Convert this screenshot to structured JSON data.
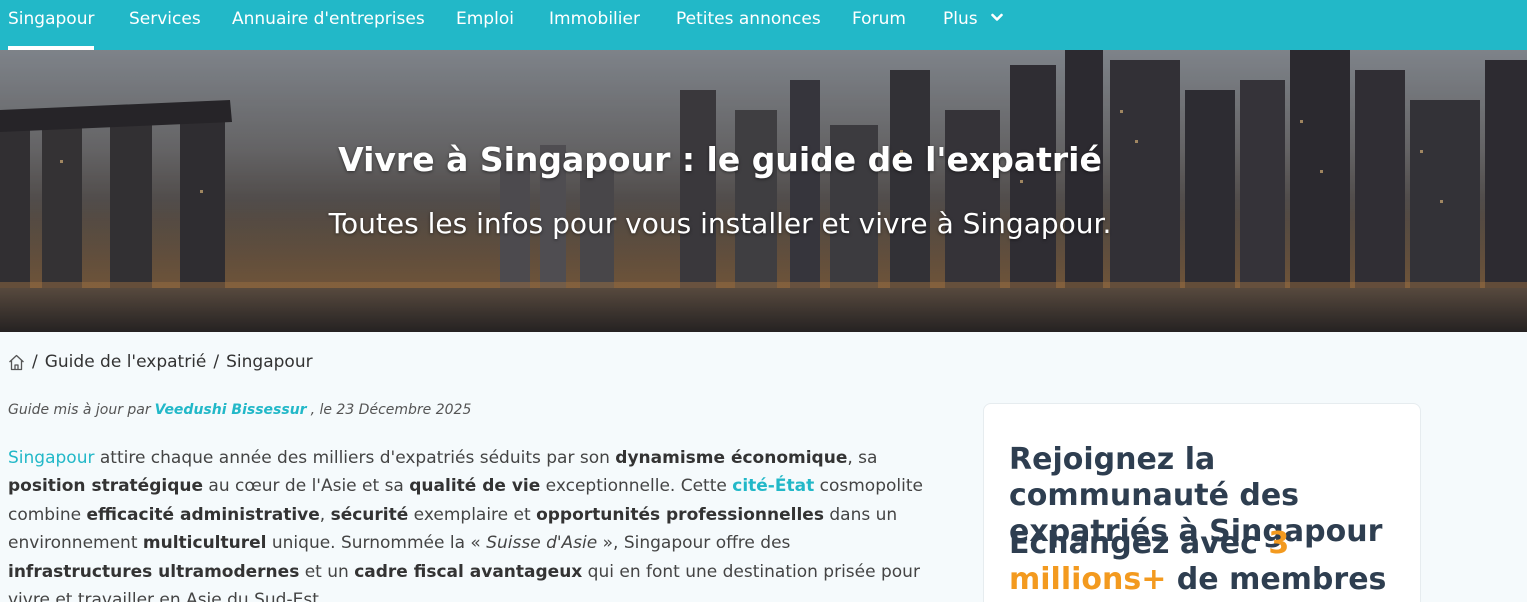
{
  "nav": {
    "items": [
      {
        "label": "Singapour"
      },
      {
        "label": "Services"
      },
      {
        "label": "Annuaire d'entreprises"
      },
      {
        "label": "Emploi"
      },
      {
        "label": "Immobilier"
      },
      {
        "label": "Petites annonces"
      },
      {
        "label": "Forum"
      },
      {
        "label": "Plus"
      }
    ],
    "active_color": "#ffffff",
    "background": "#22b8c8"
  },
  "hero": {
    "title": "Vivre à Singapour : le guide de l'expatrié",
    "subtitle": "Toutes les infos pour vous installer et vivre à Singapour."
  },
  "breadcrumb": {
    "items": [
      "Guide de l'expatrié",
      "Singapour"
    ],
    "separator": "/"
  },
  "updated": {
    "prefix": "Guide mis à jour par",
    "author": "Veedushi Bissessur",
    "suffix": ", le 23 Décembre 2025"
  },
  "intro": {
    "parts": [
      "Singapour",
      " attire chaque année des milliers d'expatriés séduits par son ",
      "dynamisme économique",
      ", sa ",
      "position stratégique",
      " au cœur de l'Asie et sa ",
      "qualité de vie",
      " exceptionnelle. Cette ",
      "cité-État",
      " cosmopolite combine ",
      "efficacité administrative",
      ", ",
      "sécurité",
      " exemplaire et ",
      "opportunités professionnelles",
      " dans un environnement ",
      "multiculturel",
      " unique. Surnommée la « ",
      "Suisse d'Asie",
      " », Singapour offre des ",
      "infrastructures ultramodernes",
      " et un ",
      "cadre fiscal avantageux",
      " qui en font une destination prisée pour vivre et travailler en Asie du Sud-Est."
    ]
  },
  "card": {
    "title": "Rejoignez la communauté des expatriés à Singapour",
    "sub_prefix": "Echangez avec ",
    "sub_number": "3 millions+",
    "sub_suffix": " de membres",
    "accent": "#f39a1f"
  }
}
